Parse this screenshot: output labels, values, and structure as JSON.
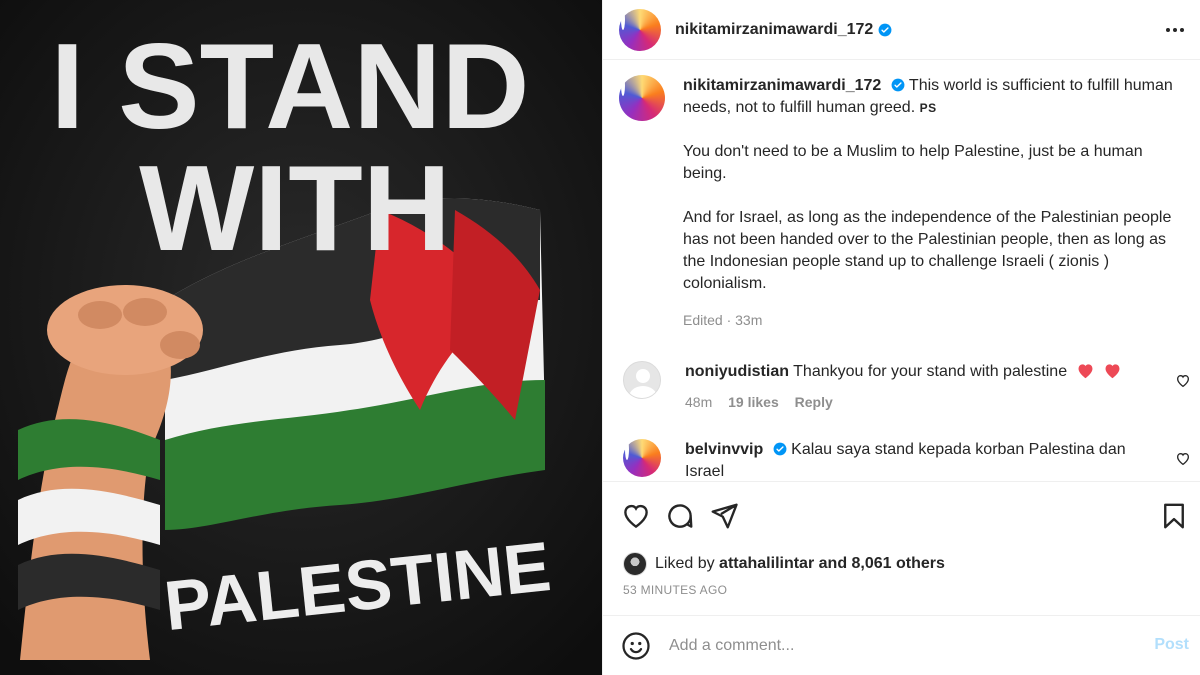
{
  "image": {
    "line1": "I STAND",
    "line2": "WITH",
    "line3": "PALESTINE",
    "colors": {
      "background": "#141414",
      "text": "#e8e8e8",
      "red": "#d7262c",
      "green": "#2e7d32",
      "black": "#2b2b2b",
      "white": "#f2f2f2",
      "skin": "#e09a70"
    }
  },
  "header": {
    "username": "nikitamirzanimawardi_172"
  },
  "caption": {
    "username": "nikitamirzanimawardi_172",
    "line1": "This world is sufficient to fulfill human needs, not to fulfill human greed.",
    "ps": "PS",
    "para2": "You don't need to be a Muslim to help Palestine, just be a human being.",
    "para3": "And for Israel, as long as the independence of the Palestinian people has not been handed over to the Palestinian people, then as long as the Indonesian people stand up to challenge Israeli ( zionis ) colonialism.",
    "meta": "Edited · 33m"
  },
  "comments": [
    {
      "username": "noniyudistian",
      "text": "Thankyou for your stand with palestine",
      "time": "48m",
      "likes": "19 likes",
      "reply": "Reply"
    },
    {
      "username": "belvinvvip",
      "text": "Kalau saya stand kepada korban Palestina dan Israel"
    }
  ],
  "likes": {
    "prefix": "Liked by",
    "user": "attahalilintar",
    "rest": "and 8,061 others"
  },
  "time_ago": "53 MINUTES AGO",
  "add_comment": {
    "placeholder": "Add a comment...",
    "post": "Post"
  },
  "accent": {
    "verified": "#0095f6",
    "heart": "#ed4956"
  }
}
